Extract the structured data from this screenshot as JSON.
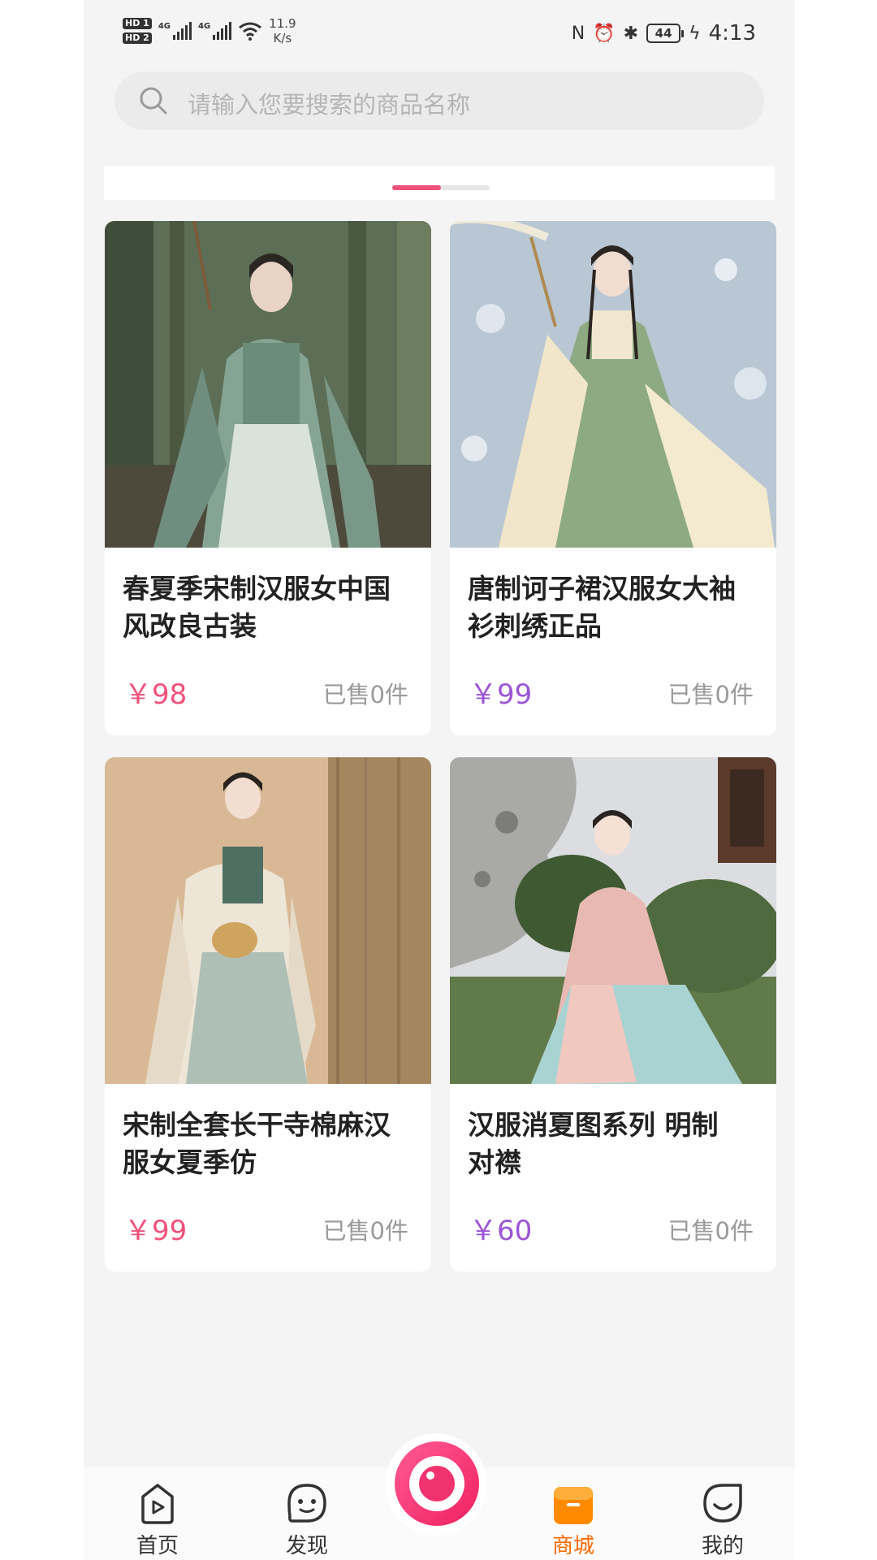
{
  "status_bar": {
    "hd1": "HD 1",
    "hd2": "HD 2",
    "net1": "4G",
    "net2": "4G",
    "speed_value": "11.9",
    "speed_unit": "K/s",
    "nfc": "N",
    "alarm": "⏰",
    "bluetooth": "✱",
    "battery": "44",
    "charging": "ϟ",
    "time": "4:13"
  },
  "search": {
    "placeholder": "请输入您要搜索的商品名称"
  },
  "banner": {
    "indicator_count": 2,
    "active_index": 0,
    "accent": "#f0517b"
  },
  "products": [
    {
      "title": "春夏季宋制汉服女中国风改良古装",
      "price": "￥98",
      "price_color": "#f0517b",
      "sold": "已售0件"
    },
    {
      "title": "唐制诃子裙汉服女大袖衫刺绣正品",
      "price": "￥99",
      "price_color": "#9b55d6",
      "sold": "已售0件"
    },
    {
      "title": "宋制全套长干寺棉麻汉服女夏季仿",
      "price": "￥99",
      "price_color": "#f0517b",
      "sold": "已售0件"
    },
    {
      "title": "汉服消夏图系列 明制对襟",
      "price": "￥60",
      "price_color": "#9b55d6",
      "sold": "已售0件"
    }
  ],
  "tabbar": {
    "home": "首页",
    "discover": "发现",
    "mall": "商城",
    "mine": "我的",
    "active_color": "#ff6a00"
  }
}
